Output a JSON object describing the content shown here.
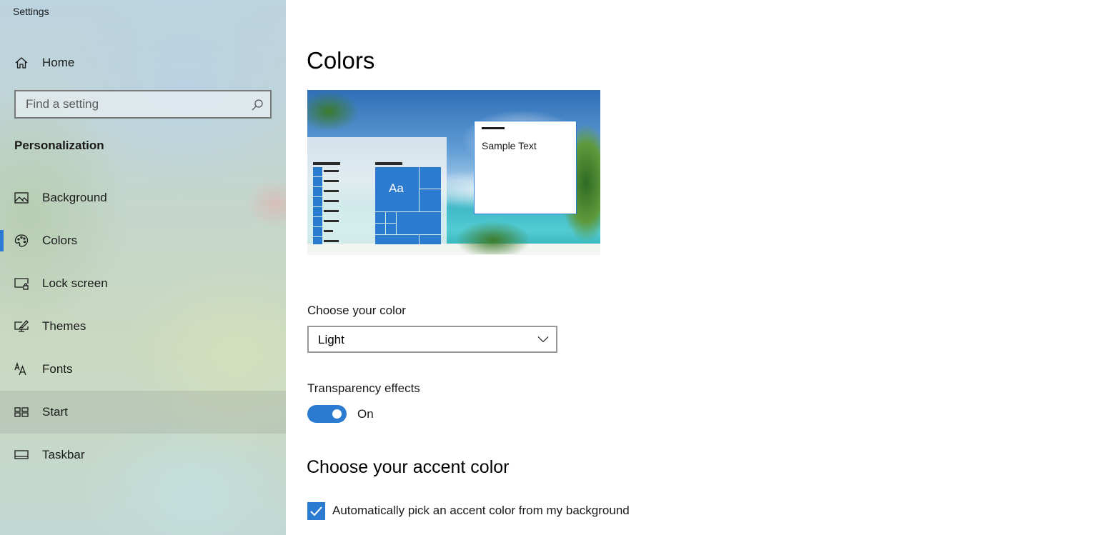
{
  "window": {
    "title": "Settings"
  },
  "sidebar": {
    "home_label": "Home",
    "search": {
      "placeholder": "Find a setting",
      "value": ""
    },
    "section_title": "Personalization",
    "items": [
      {
        "label": "Background",
        "icon": "picture-icon",
        "selected": false,
        "hovered": false
      },
      {
        "label": "Colors",
        "icon": "palette-icon",
        "selected": true,
        "hovered": false
      },
      {
        "label": "Lock screen",
        "icon": "lock-screen-icon",
        "selected": false,
        "hovered": false
      },
      {
        "label": "Themes",
        "icon": "themes-icon",
        "selected": false,
        "hovered": false
      },
      {
        "label": "Fonts",
        "icon": "fonts-icon",
        "selected": false,
        "hovered": false
      },
      {
        "label": "Start",
        "icon": "start-icon",
        "selected": false,
        "hovered": true
      },
      {
        "label": "Taskbar",
        "icon": "taskbar-icon",
        "selected": false,
        "hovered": false
      }
    ]
  },
  "main": {
    "title": "Colors",
    "preview": {
      "tile_text": "Aa",
      "sample_text": "Sample Text"
    },
    "choose_color": {
      "label": "Choose your color",
      "selected": "Light"
    },
    "transparency": {
      "label": "Transparency effects",
      "state_label": "On",
      "enabled": true
    },
    "accent_heading": "Choose your accent color",
    "auto_accent": {
      "label": "Automatically pick an accent color from my background",
      "checked": true
    }
  },
  "colors": {
    "accent": "#2b7bd0"
  }
}
